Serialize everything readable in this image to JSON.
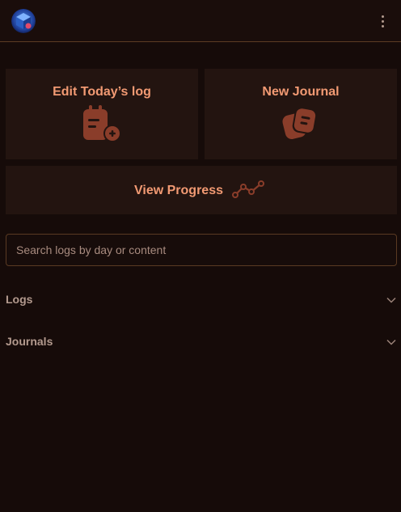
{
  "header": {
    "logo_icon": "app-logo-cube-icon",
    "menu_icon": "kebab-menu-icon"
  },
  "actions": {
    "edit_today": {
      "label": "Edit Today’s log",
      "icon": "calendar-add-icon"
    },
    "new_journal": {
      "label": "New Journal",
      "icon": "notes-stack-icon"
    },
    "view_progress": {
      "label": "View Progress",
      "icon": "trend-line-icon"
    }
  },
  "search": {
    "placeholder": "Search logs by day or content",
    "value": ""
  },
  "sections": {
    "logs": {
      "label": "Logs"
    },
    "journals": {
      "label": "Journals"
    }
  },
  "colors": {
    "background": "#160b09",
    "card": "#231410",
    "accent": "#f29a73",
    "icon": "#8a3d2a",
    "border": "#5a3a22"
  }
}
